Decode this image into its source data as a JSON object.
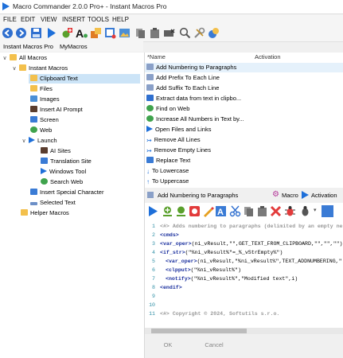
{
  "window": {
    "title": "Macro Commander 2.0.0 Pro+ - Instant Macros Pro"
  },
  "menu": [
    "FILE",
    "EDIT",
    "VIEW",
    "INSERT",
    "TOOLS",
    "HELP"
  ],
  "toolbar": {
    "icons": [
      "back-icon",
      "forward-icon",
      "save-icon",
      "run-icon",
      "add-macro-icon",
      "text-icon",
      "edit-icon",
      "insert-icon",
      "image-icon",
      "copy-icon",
      "delete-icon",
      "hide-icon",
      "search-icon",
      "tools-icon",
      "help-icon"
    ]
  },
  "tabs": [
    {
      "label": "Instant Macros Pro"
    },
    {
      "label": "MyMacros"
    }
  ],
  "tree": {
    "items": [
      {
        "label": "All Macros",
        "icon": "folder-icon",
        "color": "#f3c04c"
      },
      {
        "label": "Instant Macros",
        "icon": "folder-icon",
        "color": "#f3c04c"
      },
      {
        "label": "Clipboard Text",
        "icon": "folder-icon",
        "color": "#f3c04c"
      },
      {
        "label": "Files",
        "icon": "folder-icon",
        "color": "#f3c04c"
      },
      {
        "label": "Images",
        "icon": "image-icon",
        "color": "#4b8fd6"
      },
      {
        "label": "Insert AI Prompt",
        "icon": "ai-icon",
        "color": "#5a3d2e"
      },
      {
        "label": "Screen",
        "icon": "screen-icon",
        "color": "#3a7bd5"
      },
      {
        "label": "Web",
        "icon": "globe-icon",
        "color": "#3fa34d"
      },
      {
        "label": "Launch",
        "icon": "play-icon",
        "color": "#1e6fd9"
      },
      {
        "label": "AI Sites",
        "icon": "ai-icon",
        "color": "#5a3d2e"
      },
      {
        "label": "Translation Site",
        "icon": "translate-icon",
        "color": "#3a7bd5"
      },
      {
        "label": "Windows Tool",
        "icon": "play-icon",
        "color": "#1e6fd9"
      },
      {
        "label": "Search Web",
        "icon": "globe-icon",
        "color": "#3fa34d"
      },
      {
        "label": "Insert Special Character",
        "icon": "char-icon",
        "color": "#3a7bd5"
      },
      {
        "label": "Selected Text",
        "icon": "text-icon",
        "color": "#6c8fc7"
      },
      {
        "label": "Helper Macros",
        "icon": "folder-icon",
        "color": "#f3c04c"
      }
    ]
  },
  "list": {
    "columns": {
      "name": "*Name",
      "activation": "Activation"
    },
    "rows": [
      {
        "label": "Add Numbering to Paragraphs",
        "icon": "list-icon",
        "color": "#8aa0c8"
      },
      {
        "label": "Add Prefix To Each Line",
        "icon": "list-icon",
        "color": "#8aa0c8"
      },
      {
        "label": "Add Suffix To Each Line",
        "icon": "list-icon",
        "color": "#8aa0c8"
      },
      {
        "label": "Extract data from text in clipbo...",
        "icon": "scissors-icon",
        "color": "#2f6fcf"
      },
      {
        "label": "Find on Web",
        "icon": "globe-icon",
        "color": "#3fa34d"
      },
      {
        "label": "Increase All Numbers in Text by...",
        "icon": "globe-icon",
        "color": "#3fa34d"
      },
      {
        "label": "Open Files and Links",
        "icon": "play-icon",
        "color": "#1e6fd9"
      },
      {
        "label": "Remove All Lines",
        "icon": "arrow-icon",
        "color": "#1e6fd9"
      },
      {
        "label": "Remove Empty Lines",
        "icon": "arrow-icon",
        "color": "#1e6fd9"
      },
      {
        "label": "Replace Text",
        "icon": "replace-icon",
        "color": "#3a7bd5"
      },
      {
        "label": "To Lowercase",
        "icon": "down-arrow-icon",
        "color": "#1e6fd9"
      },
      {
        "label": "To Uppercase",
        "icon": "up-arrow-icon",
        "color": "#1e6fd9"
      }
    ]
  },
  "editor": {
    "title": "Add Numbering to Paragraphs",
    "tabs": [
      {
        "label": "Macro"
      },
      {
        "label": "Activation"
      }
    ],
    "lines": [
      {
        "n": "1",
        "text": "<#> Adds numbering to paragraphs (delimited by an empty ne",
        "kind": "cmt",
        "indent": 0
      },
      {
        "n": "2",
        "text": "<cmds>",
        "kind": "tag",
        "indent": 0
      },
      {
        "n": "3",
        "tag": "<var_oper>",
        "text": "(ni_vResult,\"\",GET_TEXT_FROM_CLIPBOARD,\"\",\"\",\"\")",
        "kind": "mixed",
        "indent": 0
      },
      {
        "n": "4",
        "tag": "<if_str>",
        "text": "(\"%ni_vResult%\"=_%_vStrEmpty%\")",
        "kind": "mixed",
        "indent": 0
      },
      {
        "n": "5",
        "tag": "<var_oper>",
        "text": "(ni_vResult,\"%ni_vResult%\",TEXT_ADDNUMBERING,\"",
        "kind": "mixed",
        "indent": 1
      },
      {
        "n": "6",
        "tag": "<clpput>",
        "text": "(\"%ni_vResult%\")",
        "kind": "mixed",
        "indent": 1
      },
      {
        "n": "7",
        "tag": "<notify>",
        "text": "(\"%ni_vResult%\",\"Modified text\",i)",
        "kind": "mixed",
        "indent": 1
      },
      {
        "n": "8",
        "text": "<endif>",
        "kind": "tag",
        "indent": 0
      },
      {
        "n": "9",
        "text": "",
        "kind": "plain",
        "indent": 0
      },
      {
        "n": "10",
        "text": "",
        "kind": "plain",
        "indent": 0
      },
      {
        "n": "11",
        "text": "<#> Copyright © 2024, Softutils s.r.o.",
        "kind": "cmt",
        "indent": 0
      }
    ]
  },
  "buttons": {
    "ok": "OK",
    "cancel": "Cancel"
  },
  "colors": {
    "accent": "#1e6fd9",
    "selection": "#cce4f7",
    "tag": "#1a2f9e",
    "linenum": "#2f8fa6"
  }
}
